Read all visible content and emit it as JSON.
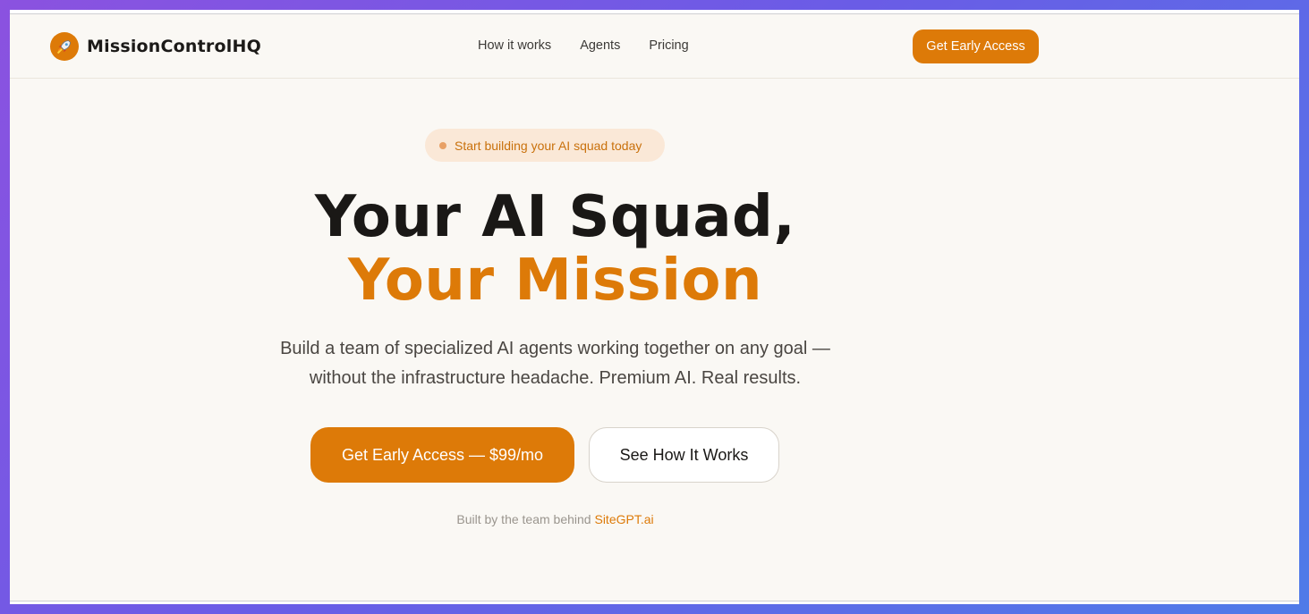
{
  "brand": {
    "name": "MissionControlHQ",
    "icon": "rocket-icon",
    "accent": "#dd7a08"
  },
  "nav": {
    "links": [
      "How it works",
      "Agents",
      "Pricing"
    ],
    "cta": "Get Early Access"
  },
  "hero": {
    "badge": "Start building your AI squad today",
    "headline_1": "Your AI Squad,",
    "headline_2": "Your Mission",
    "subtext_1": "Build a team of specialized AI agents working together on any goal —",
    "subtext_2": "without the infrastructure headache. Premium AI. Real results.",
    "cta_primary": "Get Early Access — $99/mo",
    "cta_secondary": "See How It Works",
    "credit_prefix": "Built by the team behind",
    "credit_link": "SiteGPT.ai"
  }
}
